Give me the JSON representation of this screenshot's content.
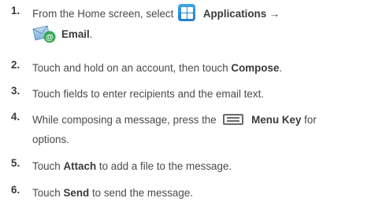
{
  "steps": [
    {
      "number": "1.",
      "line1_text": "From the Home screen, select",
      "apps_label": "Applications",
      "arrow": "→",
      "email_label": "Email",
      "end": ".",
      "icons": [
        "applications-icon",
        "email-icon"
      ]
    },
    {
      "number": "2.",
      "text": "Touch and hold on an account, then touch",
      "bold": "Compose",
      "end": "."
    },
    {
      "number": "3.",
      "text": "Touch fields to enter recipients and the email text."
    },
    {
      "number": "4.",
      "text": "While composing a message, press the",
      "bold": "Menu Key",
      "after": "for",
      "line2": "options.",
      "icons": [
        "menu-key-icon"
      ]
    },
    {
      "number": "5.",
      "pre": "Touch",
      "bold": "Attach",
      "post": "to add a file to the message."
    },
    {
      "number": "6.",
      "pre": "Touch",
      "bold": "Send",
      "post": "to send the message."
    }
  ],
  "colors": {
    "text": "#4a4a4a",
    "apps_icon": "#2a8fd8",
    "email_icon_accent": "#34a853"
  }
}
